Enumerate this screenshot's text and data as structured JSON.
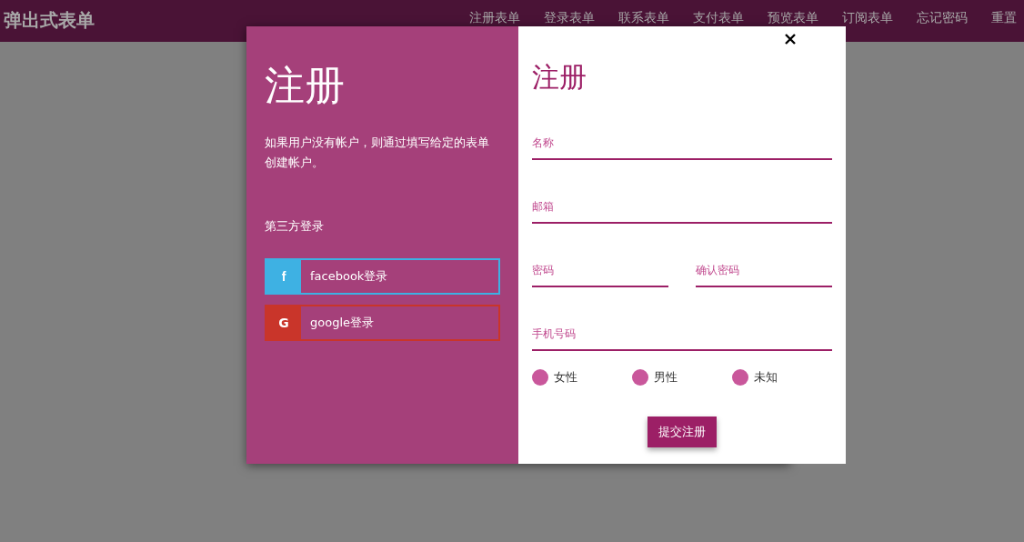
{
  "header": {
    "title": "弹出式表单",
    "nav": [
      {
        "label": "注册表单"
      },
      {
        "label": "登录表单"
      },
      {
        "label": "联系表单"
      },
      {
        "label": "支付表单"
      },
      {
        "label": "预览表单"
      },
      {
        "label": "订阅表单"
      },
      {
        "label": "忘记密码"
      },
      {
        "label": "重置"
      }
    ]
  },
  "modal": {
    "intro": {
      "title": "注册",
      "description": "如果用户没有帐户，则通过填写给定的表单创建帐户。",
      "social_heading": "第三方登录",
      "social_buttons": [
        {
          "kind": "facebook",
          "icon": "f",
          "label": "facebook登录",
          "color": "#3eb1e3"
        },
        {
          "kind": "google",
          "icon": "G",
          "label": "google登录",
          "color": "#c9352a"
        }
      ]
    },
    "form": {
      "title": "注册",
      "rows": [
        [
          {
            "placeholder": "名称"
          }
        ],
        [
          {
            "placeholder": "邮箱"
          }
        ],
        [
          {
            "placeholder": "密码"
          },
          {
            "placeholder": "确认密码"
          }
        ],
        [
          {
            "placeholder": "手机号码"
          }
        ]
      ],
      "genders": [
        {
          "label": "女性",
          "selected": false
        },
        {
          "label": "男性",
          "selected": false
        },
        {
          "label": "未知",
          "selected": false
        }
      ],
      "submit": "提交注册"
    }
  }
}
